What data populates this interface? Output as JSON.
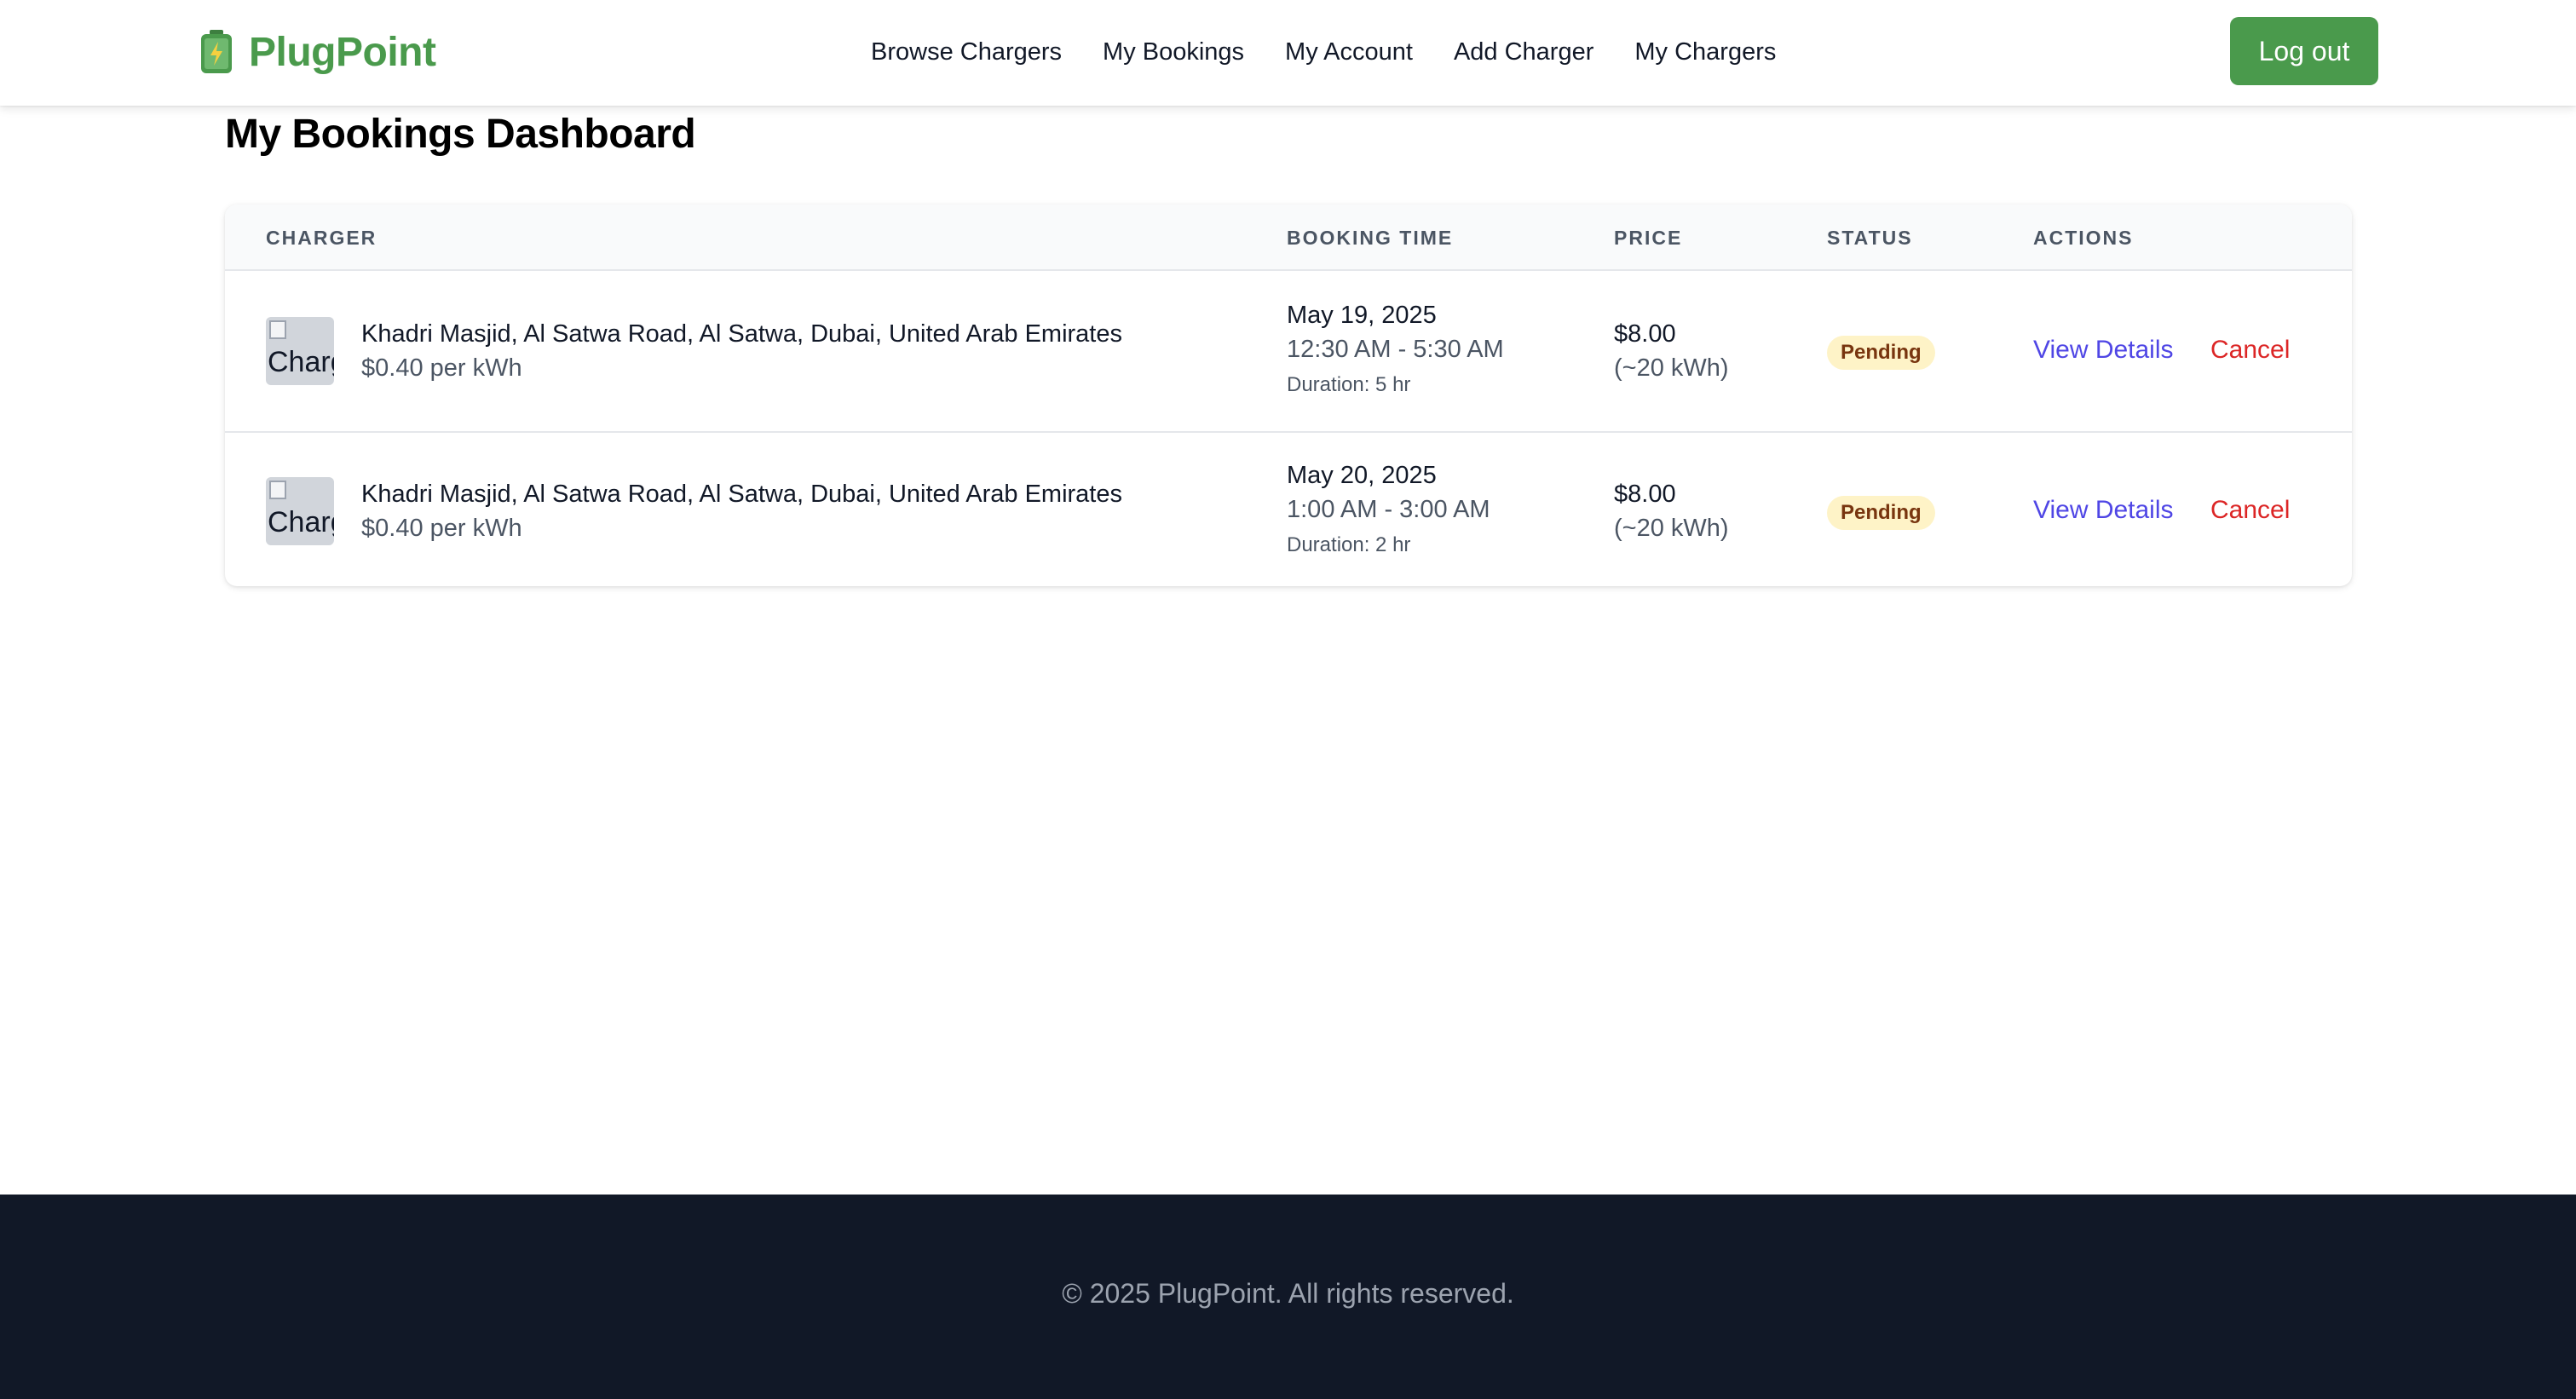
{
  "brand": {
    "name": "PlugPoint",
    "icon": "battery-icon",
    "color": "#4a9a4c"
  },
  "nav": {
    "items": [
      {
        "label": "Browse Chargers"
      },
      {
        "label": "My Bookings"
      },
      {
        "label": "My Account"
      },
      {
        "label": "Add Charger"
      },
      {
        "label": "My Chargers"
      }
    ],
    "logout_label": "Log out"
  },
  "page": {
    "title": "My Bookings Dashboard"
  },
  "table": {
    "headers": [
      "Charger",
      "Booking Time",
      "Price",
      "Status",
      "Actions"
    ],
    "rows": [
      {
        "thumb_alt": "Charger",
        "charger_name": "Khadri Masjid, Al Satwa Road, Al Satwa, Dubai, United Arab Emirates",
        "rate": "$0.40 per kWh",
        "date": "May 19, 2025",
        "time_range": "12:30 AM - 5:30 AM",
        "duration": "Duration: 5 hr",
        "price": "$8.00",
        "energy": "(~20 kWh)",
        "status": "Pending",
        "view_label": "View Details",
        "cancel_label": "Cancel"
      },
      {
        "thumb_alt": "Charger",
        "charger_name": "Khadri Masjid, Al Satwa Road, Al Satwa, Dubai, United Arab Emirates",
        "rate": "$0.40 per kWh",
        "date": "May 20, 2025",
        "time_range": "1:00 AM - 3:00 AM",
        "duration": "Duration: 2 hr",
        "price": "$8.00",
        "energy": "(~20 kWh)",
        "status": "Pending",
        "view_label": "View Details",
        "cancel_label": "Cancel"
      }
    ]
  },
  "colors": {
    "status_pending_bg": "#fef3c7",
    "status_pending_text": "#78350f",
    "link": "#4f46e5",
    "danger": "#dc2626",
    "footer_bg": "#111827"
  },
  "footer": {
    "text": "© 2025 PlugPoint. All rights reserved."
  }
}
